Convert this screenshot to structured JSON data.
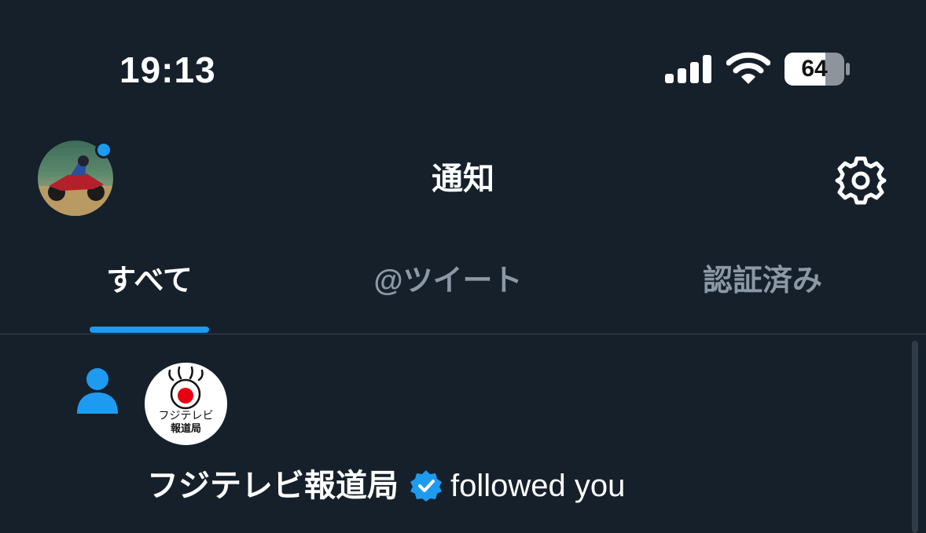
{
  "status_bar": {
    "time": "19:13",
    "battery_level": "64",
    "icons": [
      "cellular-signal-icon",
      "wifi-icon",
      "battery-icon"
    ]
  },
  "header": {
    "title": "通知",
    "has_unread_dot": true,
    "settings_icon": "gear-icon"
  },
  "tabs": [
    {
      "label": "すべて",
      "active": true
    },
    {
      "label": "@ツイート",
      "active": false
    },
    {
      "label": "認証済み",
      "active": false
    }
  ],
  "notifications": [
    {
      "type_icon": "person-icon",
      "avatar_text_line1": "フジテレビ",
      "avatar_text_line2": "報道局",
      "name": "フジテレビ報道局",
      "verified": true,
      "action": "followed you"
    }
  ],
  "colors": {
    "background": "#15202b",
    "accent": "#1d9bf0",
    "muted_text": "#8b98a5",
    "divider": "#38444d"
  }
}
